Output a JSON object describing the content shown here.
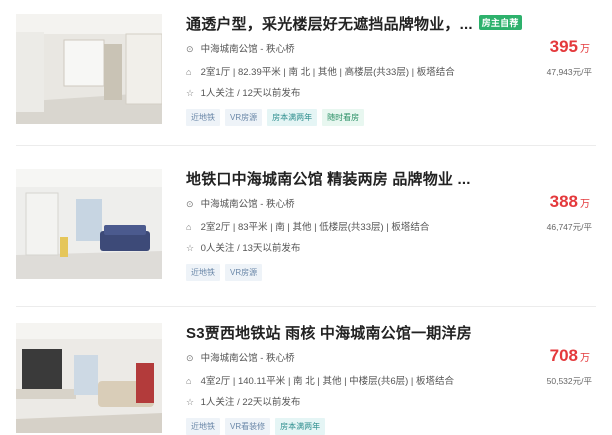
{
  "listings": [
    {
      "title": "通透户型，采光楼层好无遮挡品牌物业，...",
      "badge": "房主自荐",
      "community": "中海城南公馆 - 秩心桥",
      "info": "2室1厅 | 82.39平米 | 南 北 | 其他 | 高楼层(共33层) | 板塔结合",
      "follow": "1人关注 / 12天以前发布",
      "tags": [
        "近地铁",
        "VR房源",
        "房本满两年",
        "随时看房"
      ],
      "price": "395",
      "price_unit": "万",
      "unit_price": "47,943元/平"
    },
    {
      "title": "地铁口中海城南公馆 精装两房 品牌物业 ...",
      "badge": "",
      "community": "中海城南公馆 - 秩心桥",
      "info": "2室2厅 | 83平米 | 南 | 其他 | 低楼层(共33层) | 板塔结合",
      "follow": "0人关注 / 13天以前发布",
      "tags": [
        "近地铁",
        "VR房源"
      ],
      "price": "388",
      "price_unit": "万",
      "unit_price": "46,747元/平"
    },
    {
      "title": "S3贾西地铁站 雨核 中海城南公馆一期洋房",
      "badge": "",
      "community": "中海城南公馆 - 秩心桥",
      "info": "4室2厅 | 140.11平米 | 南 北 | 其他 | 中楼层(共6层) | 板塔结合",
      "follow": "1人关注 / 22天以前发布",
      "tags": [
        "近地铁",
        "VR看装修",
        "房本满两年"
      ],
      "price": "708",
      "price_unit": "万",
      "unit_price": "50,532元/平"
    }
  ],
  "icons": {
    "location": "location-pin-icon",
    "house": "house-icon",
    "star": "star-icon"
  },
  "colors": {
    "price": "#e4393c",
    "badge": "#2db16c",
    "tag_text": "#6a87a8",
    "tag_bg": "#eef3f8"
  }
}
